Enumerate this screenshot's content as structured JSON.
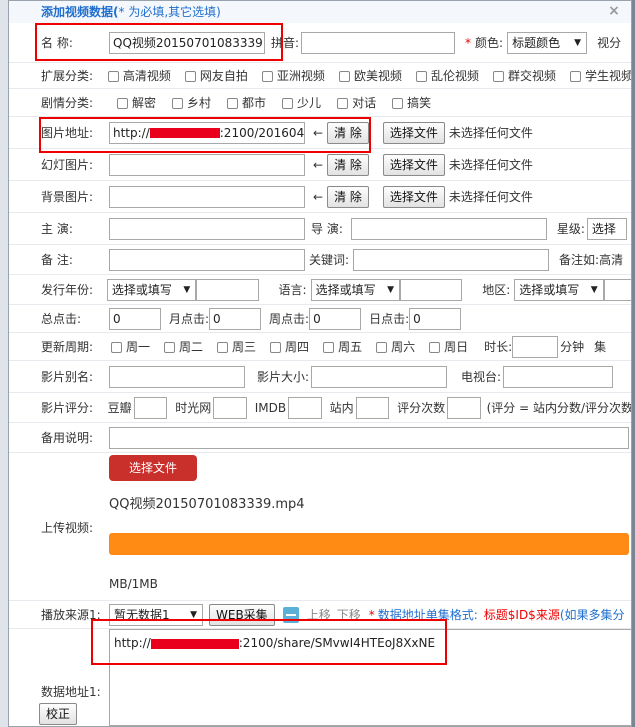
{
  "dialog": {
    "title": "添加视频数据(",
    "title_note": "* 为必填,其它选填)",
    "close_icon": "×"
  },
  "row_name": {
    "label": "名 称:",
    "name_value": "QQ视频20150701083339",
    "pinyin_label": "拼音:",
    "pinyin_value": "",
    "color_star": "*",
    "color_label": "颜色:",
    "color_select": "标题颜色",
    "trailing": "视分"
  },
  "row_ext": {
    "label": "扩展分类:",
    "options": [
      "高清视频",
      "网友自拍",
      "亚洲视频",
      "欧美视频",
      "乱伦视频",
      "群交视频",
      "学生视频"
    ]
  },
  "row_plot": {
    "label": "剧情分类:",
    "options": [
      "解密",
      "乡村",
      "都市",
      "少儿",
      "对话",
      "搞笑"
    ]
  },
  "row_pic": {
    "label": "图片地址:",
    "value_prefix": "http://",
    "value_suffix": ":2100/201604",
    "arrow": "←",
    "clear": "清 除",
    "choose": "选择文件",
    "none": "未选择任何文件"
  },
  "row_slide": {
    "label": "幻灯图片:",
    "arrow": "←",
    "clear": "清 除",
    "choose": "选择文件",
    "none": "未选择任何文件"
  },
  "row_bg": {
    "label": "背景图片:",
    "arrow": "←",
    "clear": "清 除",
    "choose": "选择文件",
    "none": "未选择任何文件"
  },
  "row_actor": {
    "label": "主 演:",
    "director_label": "导 演:",
    "star_label": "星级:",
    "star_select": "选择"
  },
  "row_note": {
    "label": "备 注:",
    "keyword_label": "关键词:",
    "note_example": "备注如:高清"
  },
  "row_year": {
    "label": "发行年份:",
    "year_select": "选择或填写",
    "lang_label": "语言:",
    "lang_select": "选择或填写",
    "area_label": "地区:",
    "area_select": "选择或填写"
  },
  "row_hits": {
    "total_label": "总点击:",
    "total": "0",
    "month_label": "月点击:",
    "month": "0",
    "week_label": "周点击:",
    "week": "0",
    "day_label": "日点击:",
    "day": "0"
  },
  "row_period": {
    "label": "更新周期:",
    "days": [
      "周一",
      "周二",
      "周三",
      "周四",
      "周五",
      "周六",
      "周日"
    ],
    "duration_label": "时长:",
    "minute": "分钟",
    "trailing": "集"
  },
  "row_alias": {
    "label": "影片别名:",
    "size_label": "影片大小:",
    "tv_label": "电视台:"
  },
  "row_score": {
    "label": "影片评分:",
    "douban": "豆瓣",
    "mtime": "时光网",
    "imdb": "IMDB",
    "site": "站内",
    "count": "评分次数",
    "formula": "(评分 = 站内分数/评分次数"
  },
  "row_remark": {
    "label": "备用说明:"
  },
  "upload": {
    "label": "上传视频:",
    "choose": "选择文件",
    "filename": "QQ视频20150701083339.mp4",
    "size": "MB/1MB",
    "progress": 1.0,
    "progress_color": "#ff8a14"
  },
  "row_source": {
    "label": "播放来源1:",
    "select": "暂无数据1",
    "web_btn": "WEB采集",
    "minus_icon": "minus-icon",
    "up": "上移",
    "down": "下移",
    "star": "*",
    "format_label": "数据地址单集格式:",
    "format": "标题$ID$来源",
    "more": "(如果多集分"
  },
  "data_addr": {
    "label": "数据地址1:",
    "fix_btn": "校正",
    "value_prefix": "http://",
    "value_suffix": ":2100/share/SMvwI4HTEoJ8XxNE"
  }
}
